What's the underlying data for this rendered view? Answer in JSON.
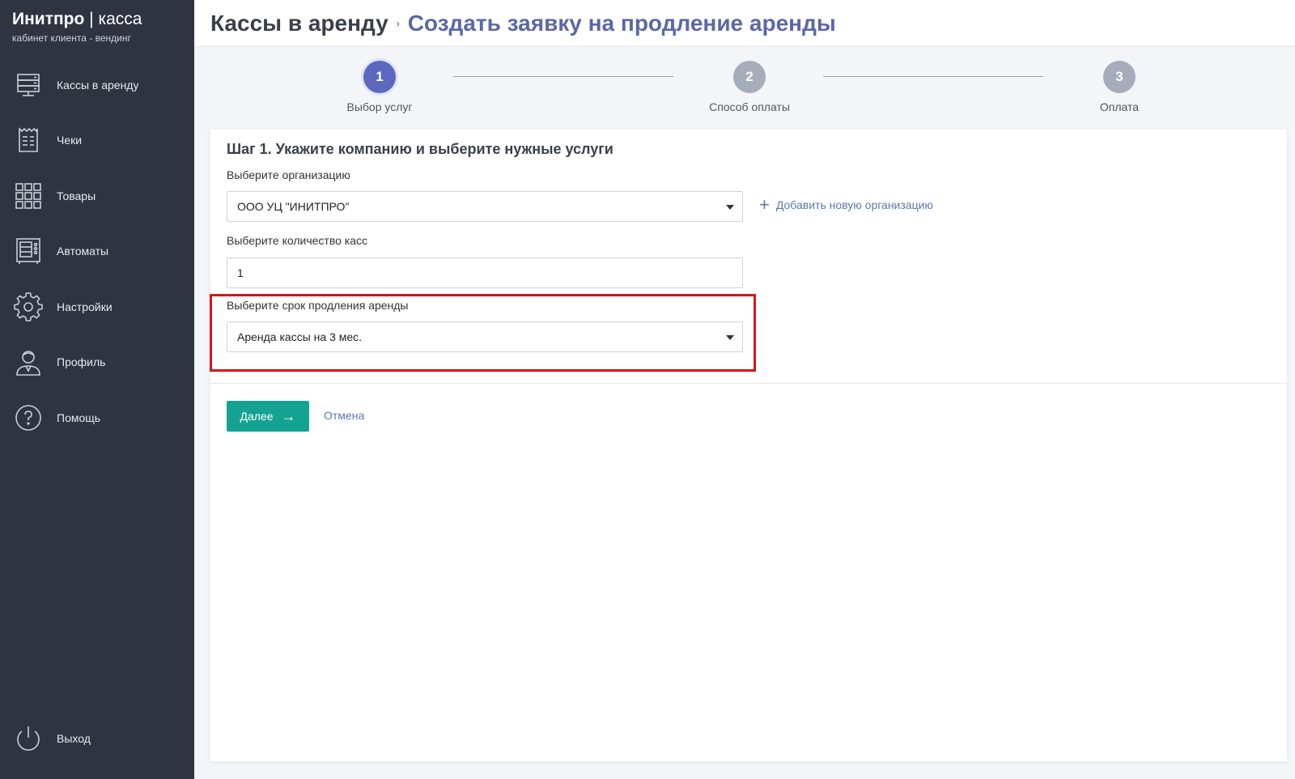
{
  "brand": {
    "title_bold": "Инитпро",
    "title_sep": " | ",
    "title_rest": "касса",
    "subtitle": "кабинет клиента - вендинг"
  },
  "sidebar": {
    "items": [
      {
        "label": "Кассы в аренду",
        "icon": "server-icon"
      },
      {
        "label": "Чеки",
        "icon": "receipt-icon"
      },
      {
        "label": "Товары",
        "icon": "grid-icon"
      },
      {
        "label": "Автоматы",
        "icon": "vending-machine-icon"
      },
      {
        "label": "Настройки",
        "icon": "gear-icon"
      },
      {
        "label": "Профиль",
        "icon": "user-icon"
      },
      {
        "label": "Помощь",
        "icon": "help-icon"
      }
    ],
    "logout": {
      "label": "Выход",
      "icon": "power-icon"
    }
  },
  "header": {
    "root": "Кассы в аренду",
    "separator": "›",
    "current": "Создать заявку на продление аренды"
  },
  "stepper": {
    "steps": [
      {
        "number": "1",
        "label": "Выбор услуг",
        "active": true
      },
      {
        "number": "2",
        "label": "Способ оплаты",
        "active": false
      },
      {
        "number": "3",
        "label": "Оплата",
        "active": false
      }
    ]
  },
  "form": {
    "title": "Шаг 1. Укажите компанию и выберите нужные услуги",
    "org_label": "Выберите организацию",
    "org_value": "ООО УЦ \"ИНИТПРО\"",
    "add_org": "Добавить новую организацию",
    "count_label": "Выберите количество касс",
    "count_value": "1",
    "term_label": "Выберите срок продления аренды",
    "term_value": "Аренда кассы на 3 мес.",
    "next_label": "Далее",
    "cancel_label": "Отмена"
  },
  "colors": {
    "sidebar_bg": "#2f3440",
    "accent": "#5b68be",
    "primary_button": "#14a392",
    "highlight": "#d9141a",
    "link": "#5b78b0"
  }
}
